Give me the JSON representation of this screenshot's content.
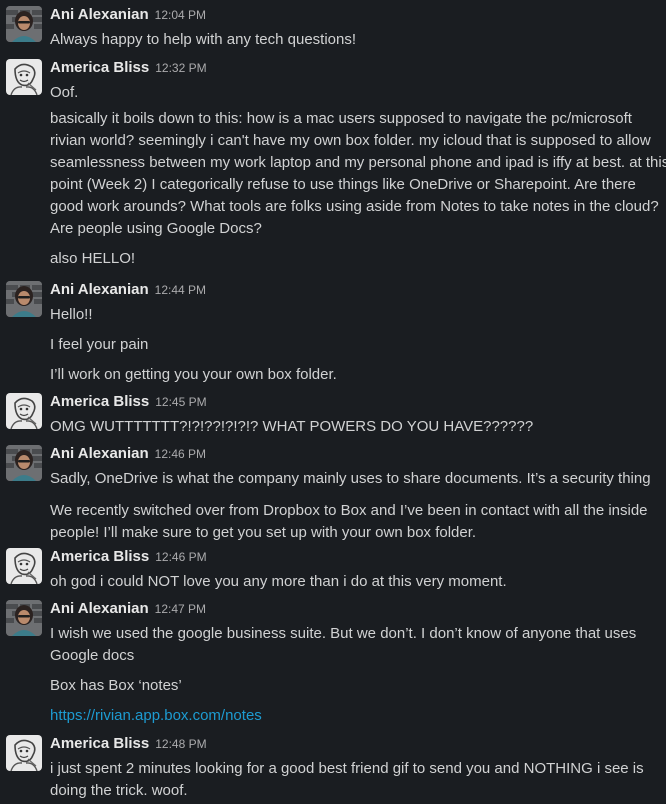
{
  "colors": {
    "background": "#1a1d21",
    "text": "#d1d2d3",
    "author": "#e8e8e8",
    "timestamp": "#ababad",
    "link": "#1d9bd1"
  },
  "messages": [
    {
      "author": "Ani Alexanian",
      "time": "12:04 PM",
      "avatar": "ani-avatar",
      "paragraphs": [
        {
          "lines": [
            "Always happy to help with any tech questions!"
          ]
        }
      ]
    },
    {
      "author": "America Bliss",
      "time": "12:32 PM",
      "avatar": "america-avatar",
      "paragraphs": [
        {
          "lines": [
            "Oof."
          ]
        },
        {
          "lines": [
            "basically it boils down to this: how is a mac users supposed to navigate the pc/microsoft",
            "rivian world? seemingly i can't have my own box folder. my icloud that is supposed to allow",
            "seamlessness between my work laptop and my personal phone and ipad is iffy at best.  at this",
            "point (Week 2) I categorically refuse to use things like OneDrive or Sharepoint. Are there",
            "good work arounds? What tools are folks using aside from Notes to take notes in the cloud?",
            "Are people using Google Docs?"
          ]
        },
        {
          "lines": [
            "also HELLO!"
          ]
        }
      ]
    },
    {
      "author": "Ani Alexanian",
      "time": "12:44 PM",
      "avatar": "ani-avatar",
      "paragraphs": [
        {
          "lines": [
            "Hello!!"
          ]
        },
        {
          "lines": [
            "I feel your pain"
          ]
        },
        {
          "lines": [
            "I’ll work on getting you your own box folder."
          ]
        }
      ]
    },
    {
      "author": "America Bliss",
      "time": "12:45 PM",
      "avatar": "america-avatar",
      "paragraphs": [
        {
          "lines": [
            "OMG WUTTTTTTT?!?!??!?!?!? WHAT POWERS DO YOU HAVE??????"
          ]
        }
      ]
    },
    {
      "author": "Ani Alexanian",
      "time": "12:46 PM",
      "avatar": "ani-avatar",
      "paragraphs": [
        {
          "lines": [
            "Sadly, OneDrive is what the company mainly uses to share documents. It’s a security thing"
          ]
        },
        {
          "lines": [
            "We recently switched over from Dropbox to Box and I’ve been in contact with all the inside",
            "people! I’ll make sure to get you set up with your own box folder."
          ]
        }
      ]
    },
    {
      "author": "America Bliss",
      "time": "12:46 PM",
      "avatar": "america-avatar",
      "paragraphs": [
        {
          "lines": [
            "oh god i could NOT love you any more than i do at this very moment."
          ]
        }
      ]
    },
    {
      "author": "Ani Alexanian",
      "time": "12:47 PM",
      "avatar": "ani-avatar",
      "paragraphs": [
        {
          "lines": [
            "I wish we used the google business suite. But we don’t. I don’t know of anyone that uses",
            "Google docs"
          ]
        },
        {
          "lines": [
            "Box has Box ‘notes’"
          ]
        },
        {
          "lines": [
            "https://rivian.app.box.com/notes"
          ],
          "link": true
        }
      ]
    },
    {
      "author": "America Bliss",
      "time": "12:48 PM",
      "avatar": "america-avatar",
      "paragraphs": [
        {
          "lines": [
            "i just spent 2 minutes looking for a good best friend gif to send you and NOTHING i see is",
            "doing the trick. woof."
          ]
        }
      ]
    }
  ]
}
